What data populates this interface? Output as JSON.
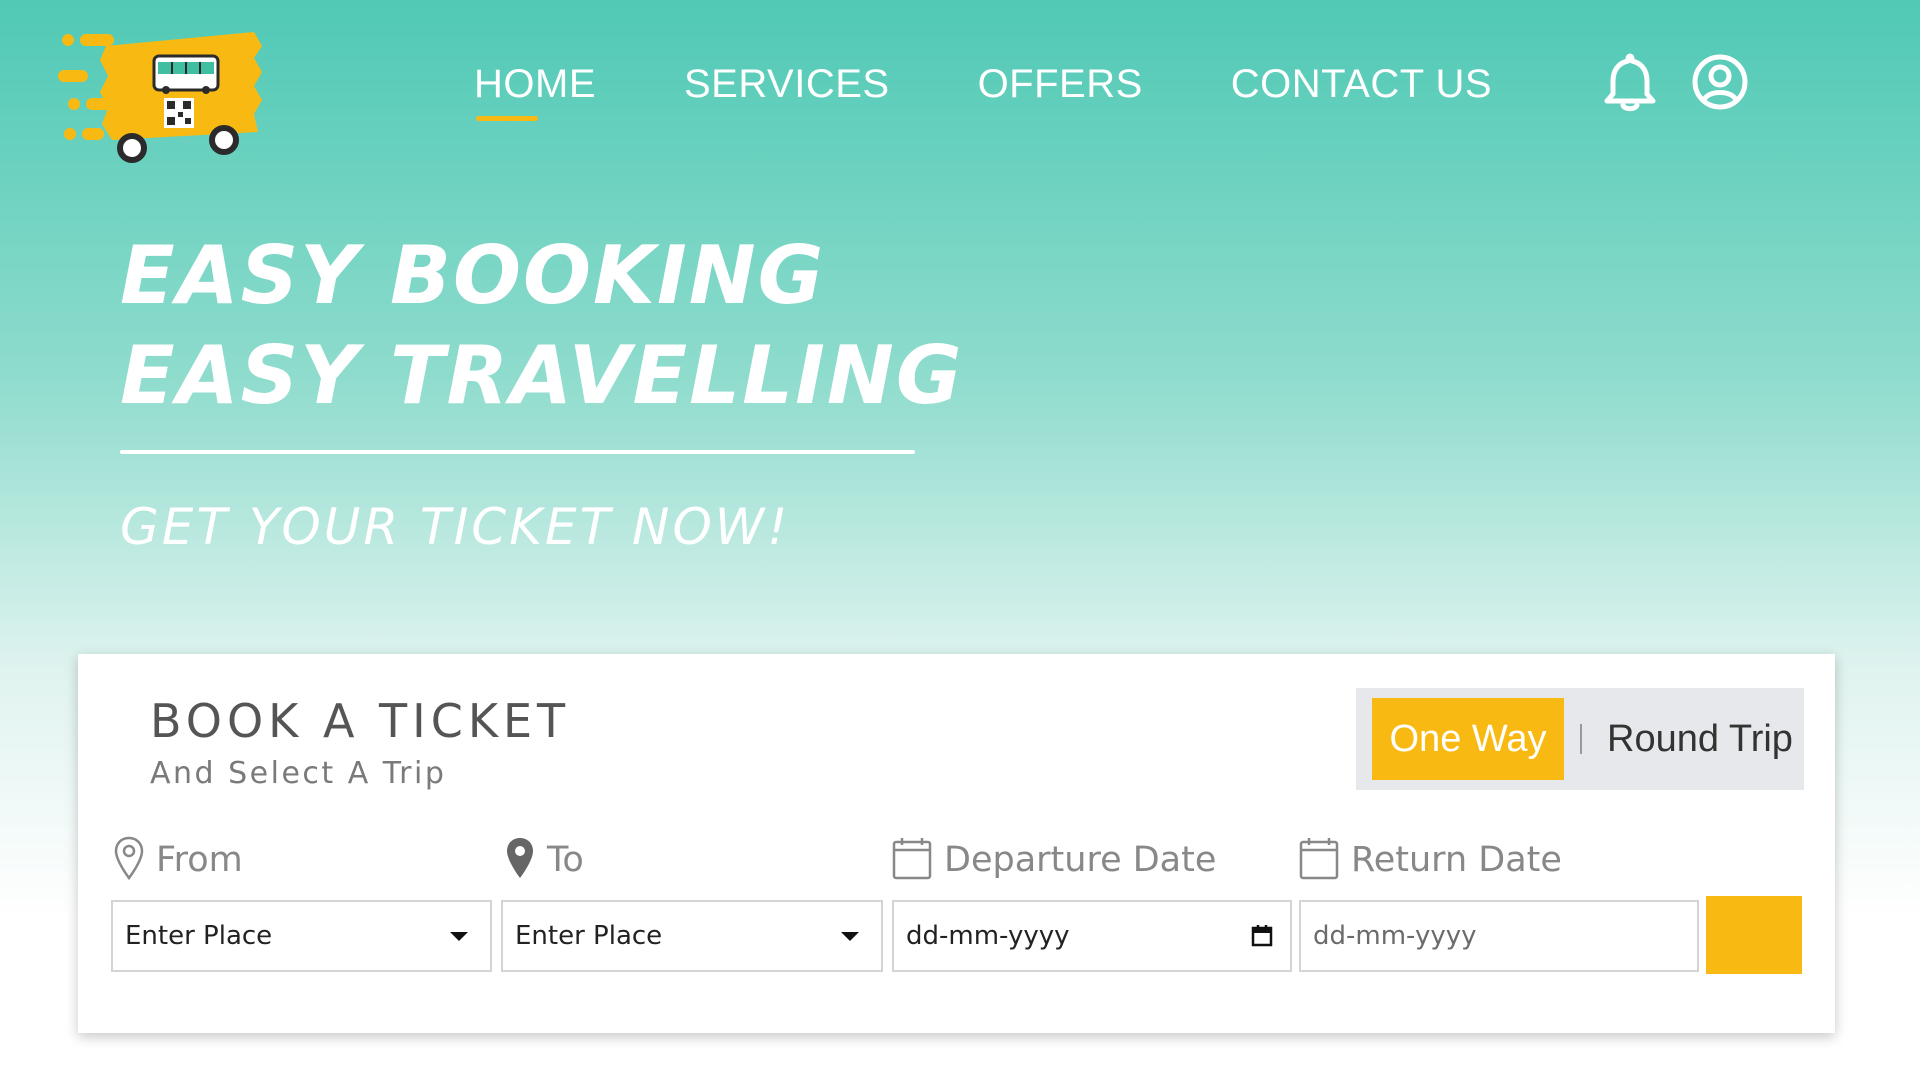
{
  "nav": {
    "items": [
      {
        "label": "HOME",
        "active": true
      },
      {
        "label": "SERVICES",
        "active": false
      },
      {
        "label": "OFFERS",
        "active": false
      },
      {
        "label": "CONTACT US",
        "active": false
      }
    ],
    "icons": [
      "bell-icon",
      "user-account-icon"
    ]
  },
  "hero": {
    "line1": "EASY BOOKING",
    "line2": "EASY TRAVELLING",
    "subtitle": "GET YOUR TICKET NOW!"
  },
  "booking": {
    "title": "BOOK A TICKET",
    "subtitle": "And Select A Trip",
    "trip_types": {
      "one_way": "One Way",
      "round_trip": "Round Trip",
      "selected": "One Way"
    },
    "from": {
      "label": "From",
      "value": "Enter Place",
      "icon": "map-pin-outline-icon"
    },
    "to": {
      "label": "To",
      "value": "Enter Place",
      "icon": "map-pin-filled-icon"
    },
    "departure": {
      "label": "Departure Date",
      "value": "dd-mm-yyyy",
      "icon": "calendar-icon"
    },
    "return": {
      "label": "Return Date",
      "value": "dd-mm-yyyy",
      "icon": "calendar-icon"
    }
  },
  "colors": {
    "accent": "#f8b912",
    "header_teal": "#4fc9b5",
    "text_gray": "#555555"
  }
}
